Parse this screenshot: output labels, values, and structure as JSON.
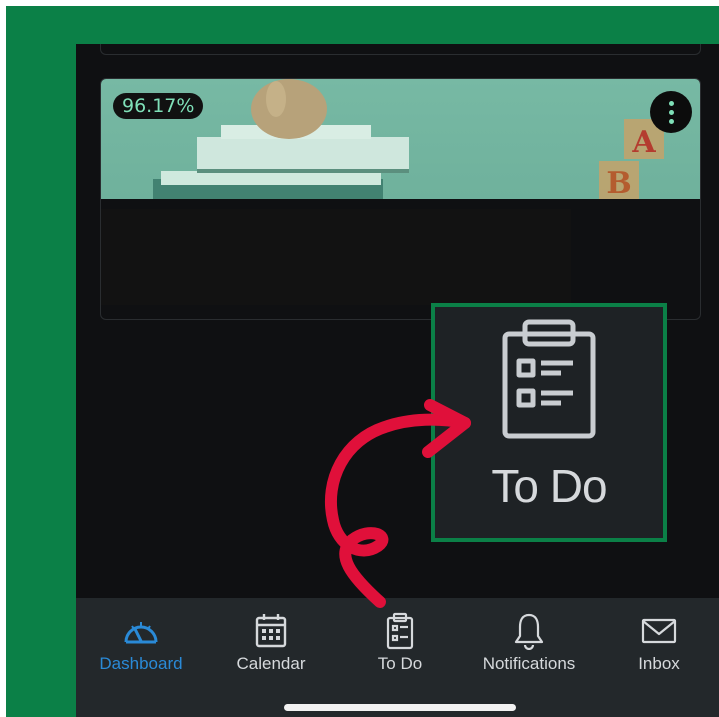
{
  "course_card": {
    "grade": "96.17%"
  },
  "zoom_callout": {
    "label": "To Do"
  },
  "tabbar": {
    "items": [
      {
        "label": "Dashboard",
        "icon": "dashboard-gauge-icon",
        "active": true
      },
      {
        "label": "Calendar",
        "icon": "calendar-icon",
        "active": false
      },
      {
        "label": "To Do",
        "icon": "clipboard-icon",
        "active": false
      },
      {
        "label": "Notifications",
        "icon": "bell-icon",
        "active": false
      },
      {
        "label": "Inbox",
        "icon": "envelope-icon",
        "active": false
      }
    ]
  },
  "colors": {
    "accent_green": "#0b8047",
    "active_tab": "#2a8ad7",
    "annotation_arrow": "#e0103a"
  }
}
